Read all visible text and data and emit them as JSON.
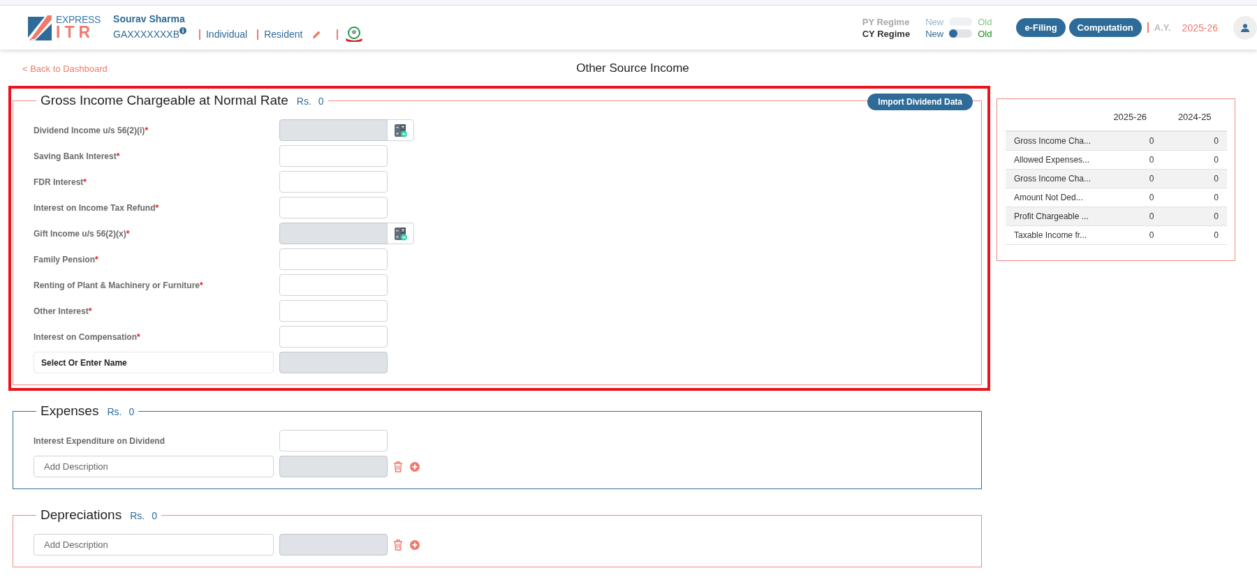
{
  "header": {
    "logo": {
      "top": "EXPRESS",
      "bottom": "ITR"
    },
    "user": {
      "name": "Sourav Sharma",
      "pan": "GAXXXXXXXB",
      "type": "Individual",
      "residency": "Resident"
    },
    "regimes": [
      {
        "label": "PY Regime",
        "new": "New",
        "old": "Old",
        "disabled": true
      },
      {
        "label": "CY Regime",
        "new": "New",
        "old": "Old",
        "disabled": false,
        "on": false
      }
    ],
    "buttons": [
      "e-Filing",
      "Computation"
    ],
    "ay": {
      "label": "A.Y.",
      "value": "2025-26"
    }
  },
  "back_link": "< Back to Dashboard",
  "page_title": "Other Source Income",
  "sections": [
    {
      "title": "Gross Income Chargeable at Normal Rate",
      "currency": "Rs.",
      "amount": "0",
      "color": "#f08a80",
      "highlighted": true,
      "action": "Import Dividend Data",
      "fields": [
        {
          "kind": "calc",
          "label": "Dividend Income u/s 56(2)(i)",
          "required_mark": "*",
          "disabled": true
        },
        {
          "kind": "input",
          "label": "Saving Bank Interest",
          "required_mark": "*",
          "disabled": false
        },
        {
          "kind": "input",
          "label": "FDR Interest",
          "required_mark": "*",
          "disabled": false
        },
        {
          "kind": "input",
          "label": "Interest on Income Tax Refund",
          "required_mark": "*",
          "disabled": false
        },
        {
          "kind": "calc",
          "label": "Gift Income u/s 56(2)(x)",
          "required_mark": "*",
          "disabled": true
        },
        {
          "kind": "input",
          "label": "Family Pension",
          "required_mark": "*",
          "disabled": false
        },
        {
          "kind": "input",
          "label": "Renting of Plant & Machinery or Furniture",
          "required_mark": "*",
          "disabled": false
        },
        {
          "kind": "input",
          "label": "Other Interest",
          "required_mark": "*",
          "disabled": false
        },
        {
          "kind": "input",
          "label": "Interest on Compensation",
          "required_mark": "*",
          "disabled": false
        },
        {
          "kind": "select",
          "placeholder": "Select Or Enter Name",
          "disabled": true
        }
      ]
    },
    {
      "title": "Expenses",
      "currency": "Rs.",
      "amount": "0",
      "color": "#336e99",
      "highlighted": false,
      "fields": [
        {
          "kind": "input",
          "label": "Interest Expenditure on Dividend",
          "disabled": false
        },
        {
          "kind": "description",
          "placeholder": "Add Description",
          "disabled": true
        }
      ]
    },
    {
      "title": "Depreciations",
      "currency": "Rs.",
      "amount": "0",
      "color": "#f08a80",
      "highlighted": false,
      "fields": [
        {
          "kind": "description",
          "placeholder": "Add Description",
          "disabled": true
        }
      ]
    }
  ],
  "summary": {
    "columns": [
      "2025-26",
      "2024-25"
    ],
    "rows": [
      {
        "label": "Gross Income Cha...",
        "values": [
          "0",
          "0"
        ]
      },
      {
        "label": "Allowed Expenses...",
        "values": [
          "0",
          "0"
        ]
      },
      {
        "label": "Gross Income Cha...",
        "values": [
          "0",
          "0"
        ]
      },
      {
        "label": "Amount Not Ded...",
        "values": [
          "0",
          "0"
        ]
      },
      {
        "label": "Profit Chargeable ...",
        "values": [
          "0",
          "0"
        ]
      },
      {
        "label": "Taxable Income fr...",
        "values": [
          "0",
          "0"
        ]
      }
    ]
  }
}
